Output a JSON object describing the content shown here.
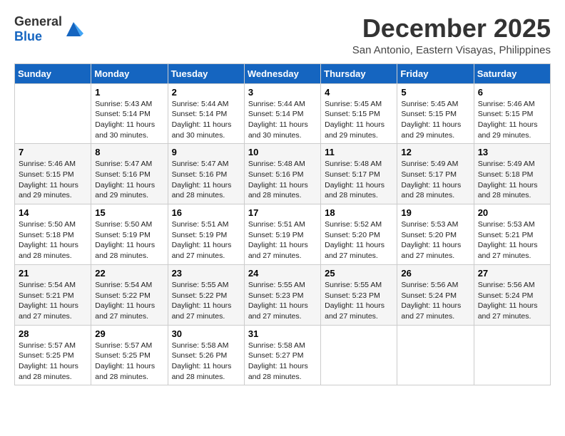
{
  "header": {
    "logo_general": "General",
    "logo_blue": "Blue",
    "month_title": "December 2025",
    "location": "San Antonio, Eastern Visayas, Philippines"
  },
  "days_of_week": [
    "Sunday",
    "Monday",
    "Tuesday",
    "Wednesday",
    "Thursday",
    "Friday",
    "Saturday"
  ],
  "weeks": [
    [
      {
        "day": "",
        "info": ""
      },
      {
        "day": "1",
        "info": "Sunrise: 5:43 AM\nSunset: 5:14 PM\nDaylight: 11 hours and 30 minutes."
      },
      {
        "day": "2",
        "info": "Sunrise: 5:44 AM\nSunset: 5:14 PM\nDaylight: 11 hours and 30 minutes."
      },
      {
        "day": "3",
        "info": "Sunrise: 5:44 AM\nSunset: 5:14 PM\nDaylight: 11 hours and 30 minutes."
      },
      {
        "day": "4",
        "info": "Sunrise: 5:45 AM\nSunset: 5:15 PM\nDaylight: 11 hours and 29 minutes."
      },
      {
        "day": "5",
        "info": "Sunrise: 5:45 AM\nSunset: 5:15 PM\nDaylight: 11 hours and 29 minutes."
      },
      {
        "day": "6",
        "info": "Sunrise: 5:46 AM\nSunset: 5:15 PM\nDaylight: 11 hours and 29 minutes."
      }
    ],
    [
      {
        "day": "7",
        "info": "Sunrise: 5:46 AM\nSunset: 5:15 PM\nDaylight: 11 hours and 29 minutes."
      },
      {
        "day": "8",
        "info": "Sunrise: 5:47 AM\nSunset: 5:16 PM\nDaylight: 11 hours and 29 minutes."
      },
      {
        "day": "9",
        "info": "Sunrise: 5:47 AM\nSunset: 5:16 PM\nDaylight: 11 hours and 28 minutes."
      },
      {
        "day": "10",
        "info": "Sunrise: 5:48 AM\nSunset: 5:16 PM\nDaylight: 11 hours and 28 minutes."
      },
      {
        "day": "11",
        "info": "Sunrise: 5:48 AM\nSunset: 5:17 PM\nDaylight: 11 hours and 28 minutes."
      },
      {
        "day": "12",
        "info": "Sunrise: 5:49 AM\nSunset: 5:17 PM\nDaylight: 11 hours and 28 minutes."
      },
      {
        "day": "13",
        "info": "Sunrise: 5:49 AM\nSunset: 5:18 PM\nDaylight: 11 hours and 28 minutes."
      }
    ],
    [
      {
        "day": "14",
        "info": "Sunrise: 5:50 AM\nSunset: 5:18 PM\nDaylight: 11 hours and 28 minutes."
      },
      {
        "day": "15",
        "info": "Sunrise: 5:50 AM\nSunset: 5:19 PM\nDaylight: 11 hours and 28 minutes."
      },
      {
        "day": "16",
        "info": "Sunrise: 5:51 AM\nSunset: 5:19 PM\nDaylight: 11 hours and 27 minutes."
      },
      {
        "day": "17",
        "info": "Sunrise: 5:51 AM\nSunset: 5:19 PM\nDaylight: 11 hours and 27 minutes."
      },
      {
        "day": "18",
        "info": "Sunrise: 5:52 AM\nSunset: 5:20 PM\nDaylight: 11 hours and 27 minutes."
      },
      {
        "day": "19",
        "info": "Sunrise: 5:53 AM\nSunset: 5:20 PM\nDaylight: 11 hours and 27 minutes."
      },
      {
        "day": "20",
        "info": "Sunrise: 5:53 AM\nSunset: 5:21 PM\nDaylight: 11 hours and 27 minutes."
      }
    ],
    [
      {
        "day": "21",
        "info": "Sunrise: 5:54 AM\nSunset: 5:21 PM\nDaylight: 11 hours and 27 minutes."
      },
      {
        "day": "22",
        "info": "Sunrise: 5:54 AM\nSunset: 5:22 PM\nDaylight: 11 hours and 27 minutes."
      },
      {
        "day": "23",
        "info": "Sunrise: 5:55 AM\nSunset: 5:22 PM\nDaylight: 11 hours and 27 minutes."
      },
      {
        "day": "24",
        "info": "Sunrise: 5:55 AM\nSunset: 5:23 PM\nDaylight: 11 hours and 27 minutes."
      },
      {
        "day": "25",
        "info": "Sunrise: 5:55 AM\nSunset: 5:23 PM\nDaylight: 11 hours and 27 minutes."
      },
      {
        "day": "26",
        "info": "Sunrise: 5:56 AM\nSunset: 5:24 PM\nDaylight: 11 hours and 27 minutes."
      },
      {
        "day": "27",
        "info": "Sunrise: 5:56 AM\nSunset: 5:24 PM\nDaylight: 11 hours and 27 minutes."
      }
    ],
    [
      {
        "day": "28",
        "info": "Sunrise: 5:57 AM\nSunset: 5:25 PM\nDaylight: 11 hours and 28 minutes."
      },
      {
        "day": "29",
        "info": "Sunrise: 5:57 AM\nSunset: 5:25 PM\nDaylight: 11 hours and 28 minutes."
      },
      {
        "day": "30",
        "info": "Sunrise: 5:58 AM\nSunset: 5:26 PM\nDaylight: 11 hours and 28 minutes."
      },
      {
        "day": "31",
        "info": "Sunrise: 5:58 AM\nSunset: 5:27 PM\nDaylight: 11 hours and 28 minutes."
      },
      {
        "day": "",
        "info": ""
      },
      {
        "day": "",
        "info": ""
      },
      {
        "day": "",
        "info": ""
      }
    ]
  ]
}
